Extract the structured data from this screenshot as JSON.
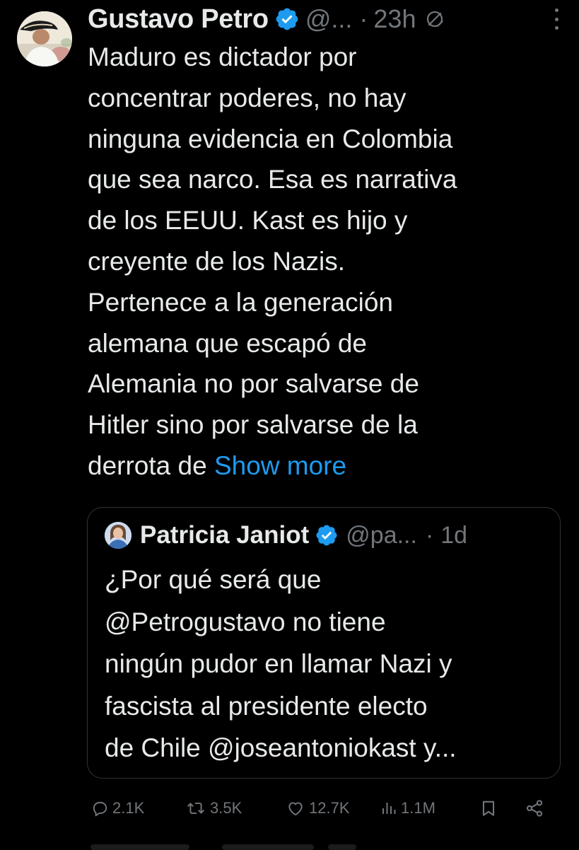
{
  "tweet": {
    "author": {
      "display_name": "Gustavo Petro",
      "handle": "@...",
      "verified": true
    },
    "separator": "·",
    "time": "23h",
    "text_lines": [
      "Maduro es dictador por",
      "concentrar poderes, no hay",
      "ninguna evidencia en Colombia",
      "que sea narco. Esa es narrativa",
      "de los EEUU. Kast es hijo y",
      "creyente de los Nazis.",
      "Pertenece a la generación",
      "alemana que escapó de",
      "Alemania no por salvarse de",
      "Hitler sino por salvarse de la",
      "derrota de "
    ],
    "show_more_label": "Show more",
    "icons": {
      "verified": "verified-badge-icon",
      "visibility": "globe-off-icon",
      "more": "more-vertical-icon"
    }
  },
  "quoted_tweet": {
    "author": {
      "display_name": "Patricia Janiot",
      "handle": "@pa...",
      "verified": true
    },
    "separator": "·",
    "time": "1d",
    "text_lines": [
      "¿Por qué será que",
      "@Petrogustavo no tiene",
      "ningún pudor en llamar Nazi y",
      "fascista al presidente electo",
      "de Chile @joseantoniokast y..."
    ]
  },
  "actions": {
    "replies": "2.1K",
    "retweets": "3.5K",
    "likes": "12.7K",
    "views": "1.1M",
    "icons": [
      "reply-icon",
      "retweet-icon",
      "like-icon",
      "views-icon",
      "bookmark-icon",
      "share-icon"
    ]
  },
  "colors": {
    "background": "#000000",
    "text": "#e7e9ea",
    "muted": "#71767b",
    "link": "#1d9bf0",
    "verified": "#1d9bf0",
    "border": "#2f3336"
  }
}
